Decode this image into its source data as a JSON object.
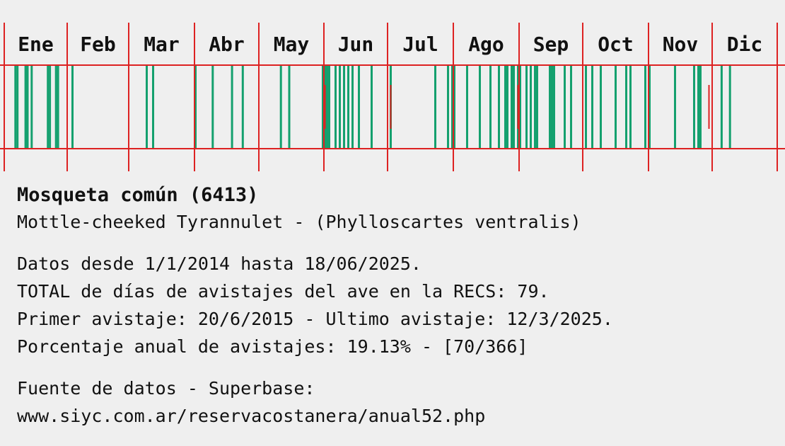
{
  "chart_data": {
    "type": "bar",
    "months": [
      "Ene",
      "Feb",
      "Mar",
      "Abr",
      "May",
      "Jun",
      "Jul",
      "Ago",
      "Sep",
      "Oct",
      "Nov",
      "Dic"
    ],
    "x_unit": "day of year",
    "sighting_days": [
      6,
      7,
      11,
      12,
      14,
      22,
      23,
      26,
      27,
      34,
      69,
      72,
      92,
      100,
      109,
      114,
      132,
      136,
      152,
      153,
      154,
      155,
      158,
      160,
      162,
      164,
      166,
      169,
      175,
      184,
      205,
      211,
      213,
      214,
      220,
      226,
      231,
      235,
      238,
      239,
      241,
      242,
      244,
      245,
      248,
      250,
      252,
      253,
      259,
      260,
      261,
      266,
      269,
      276,
      279,
      283,
      290,
      295,
      297,
      304,
      306,
      318,
      327,
      329,
      330,
      340,
      344
    ],
    "highlight_days": [
      153,
      184,
      244,
      334
    ],
    "bar_color": "#14a06e",
    "highlight_color": "#dd2222",
    "grid_color": "#dd2222"
  },
  "info": {
    "title": "Mosqueta común (6413)",
    "subtitle": "Mottle-cheeked Tyrannulet - (Phylloscartes ventralis)",
    "line1": "Datos desde 1/1/2014 hasta 18/06/2025.",
    "line2": "TOTAL de días de avistajes del ave en la RECS: 79.",
    "line3": "Primer avistaje: 20/6/2015 - Ultimo avistaje: 12/3/2025.",
    "line4": "Porcentaje anual de avistajes: 19.13% - [70/366]",
    "source": "Fuente de datos - Superbase:",
    "url": "www.siyc.com.ar/reservacostanera/anual52.php"
  }
}
